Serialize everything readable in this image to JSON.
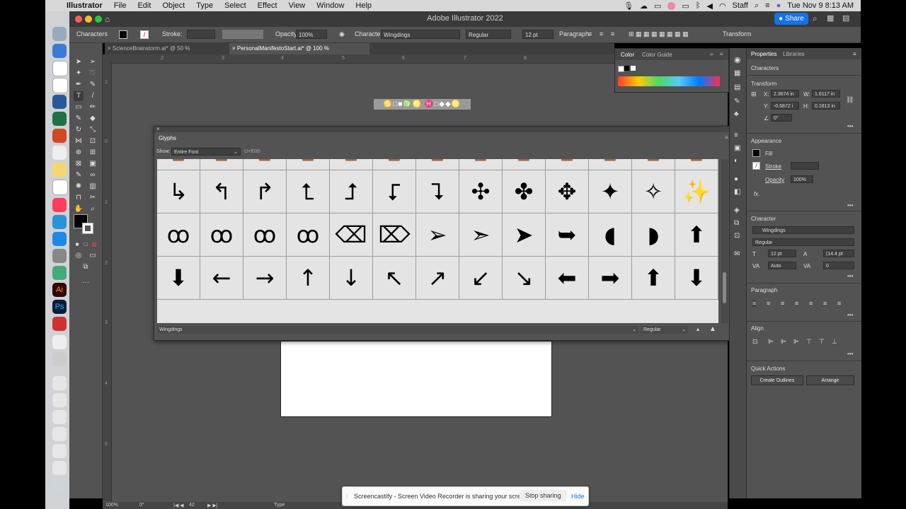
{
  "menubar": {
    "app": "Illustrator",
    "items": [
      "File",
      "Edit",
      "Object",
      "Type",
      "Select",
      "Effect",
      "View",
      "Window",
      "Help"
    ],
    "status": {
      "user": "Staff",
      "clock": "Tue Nov 9  8:13 AM"
    }
  },
  "titlebar": {
    "title": "Adobe Illustrator 2022",
    "share": "Share"
  },
  "controlbar": {
    "characters": "Characters",
    "stroke": "Stroke:",
    "opacity_label": "Opacity:",
    "opacity": "100%",
    "character_label": "Character:",
    "font": "Wingdings",
    "style": "Regular",
    "size": "12 pt",
    "paragraph": "Paragraph:",
    "transform": "Transform"
  },
  "tabs": [
    {
      "label": "ScienceBrainstorm.ai* @ 50 % (CMYK/Preview)",
      "active": false
    },
    {
      "label": "PersonalManifestoStart.ai* @ 100 % (CMYK/Preview)",
      "active": true
    }
  ],
  "ruler": {
    "h": [
      "2",
      "3",
      "4",
      "5",
      "6",
      "7",
      "8"
    ],
    "v": [
      "1",
      "0",
      "1",
      "2",
      "3",
      "4",
      "5"
    ]
  },
  "canvas_text": "♋□■♍♌ ♓□◆◆♌",
  "color_panel": {
    "tab_color": "Color",
    "tab_guide": "Color Guide"
  },
  "glyphs": {
    "title": "Glyphs",
    "show_label": "Show:",
    "show_value": "Entire Font",
    "code": "U+f035",
    "font": "Wingdings",
    "style": "Regular",
    "rows": [
      [
        "⌚",
        "⌚",
        "⌚",
        "⌚",
        "⌚",
        "⌚",
        "⌚",
        "⌚",
        "⌚",
        "⌚",
        "⌚",
        "⌚",
        "⌚"
      ],
      [
        "↳",
        "↰",
        "↱",
        "⮤",
        "⮥",
        "⮦",
        "⮧",
        "✣",
        "✤",
        "✥",
        "✦",
        "✧",
        "✨"
      ],
      [
        "ꝏ",
        "ꝏ",
        "ꝏ",
        "ꝏ",
        "⌫",
        "⌦",
        "➢",
        "➣",
        "➤",
        "➥",
        "◖",
        "◗",
        "⬆"
      ],
      [
        "⬇",
        "←",
        "→",
        "↑",
        "↓",
        "↖",
        "↗",
        "↙",
        "↘",
        "⬅",
        "➡",
        "⬆",
        "⬇"
      ]
    ]
  },
  "properties": {
    "tab_properties": "Properties",
    "tab_libraries": "Libraries",
    "characters": "Characters",
    "transform": "Transform",
    "x": "2.3674 in",
    "w": "1.6117 in",
    "y": "-0.6872 i",
    "h": "0.1813 in",
    "angle": "0°",
    "appearance": "Appearance",
    "fill": "Fill",
    "stroke": "Stroke",
    "opacity_label": "Opacity",
    "opacity": "100%",
    "fx": "fx.",
    "character": "Character",
    "font": "Wingdings",
    "style": "Regular",
    "size": "12 pt",
    "leading": "(14.4 pt",
    "kerning": "Auto",
    "tracking": "0",
    "paragraph": "Paragraph",
    "align": "Align",
    "quick_actions": "Quick Actions",
    "create_outlines": "Create Outlines",
    "arrange": "Arrange"
  },
  "statusbar": {
    "zoom": "100%",
    "rotation": "0°",
    "page": "42",
    "tool": "Type"
  },
  "notice": {
    "text": "Screencastify - Screen Video Recorder is sharing your screen.",
    "stop": "Stop sharing",
    "hide": "Hide"
  }
}
